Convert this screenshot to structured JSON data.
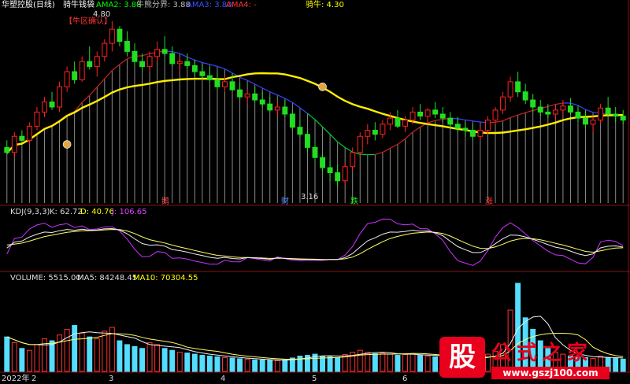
{
  "header": {
    "title": "华塑控股(日线)",
    "indicator_name": "骑牛钱袋",
    "items": [
      {
        "label": "AMA2: 3.88",
        "color": "#00ff00"
      },
      {
        "label": "牛熊分界: 3.88",
        "color": "#bbbbbb"
      },
      {
        "label": "AMA3: 3.80",
        "color": "#3355ff"
      },
      {
        "label": "AMA4: -",
        "color": "#ff3333"
      }
    ],
    "bull_label": "骑牛: 4.30",
    "bull_color": "#ffff00"
  },
  "annotations": {
    "high_price": "4.80",
    "low_price": "3.16",
    "bull_zone": "【牛区确认】",
    "markers": [
      {
        "text": "鹅",
        "color": "#ff4444"
      },
      {
        "text": "财",
        "color": "#4488ff"
      },
      {
        "text": "跌",
        "color": "#00ff00"
      },
      {
        "text": "涨",
        "color": "#ff3333"
      }
    ]
  },
  "kdj_panel": {
    "name": "KDJ(9,3,3)",
    "k_label": "K: 62.72",
    "d_label": "D: 40.76",
    "j_label": "J: 106.65"
  },
  "volume_panel": {
    "name": "VOLUME: 5515.00",
    "ma5_label": "MA5: 84248.45",
    "ma10_label": "MA10: 70304.55"
  },
  "x_axis": [
    "2022年",
    "2",
    "3",
    "4",
    "5",
    "6"
  ],
  "watermark": {
    "logo_char": "股",
    "title": "公式之家",
    "url": "www.gszj100.com"
  },
  "chart_data": {
    "type": "candlestick",
    "candles": [
      [
        3.55,
        3.62,
        3.48,
        3.5
      ],
      [
        3.5,
        3.7,
        3.45,
        3.66
      ],
      [
        3.66,
        3.72,
        3.6,
        3.62
      ],
      [
        3.62,
        3.8,
        3.58,
        3.76
      ],
      [
        3.76,
        3.95,
        3.72,
        3.9
      ],
      [
        3.9,
        4.05,
        3.85,
        4.0
      ],
      [
        4.0,
        4.1,
        3.92,
        3.95
      ],
      [
        3.95,
        4.2,
        3.9,
        4.15
      ],
      [
        4.15,
        4.35,
        4.1,
        4.3
      ],
      [
        4.3,
        4.4,
        4.18,
        4.22
      ],
      [
        4.22,
        4.45,
        4.2,
        4.4
      ],
      [
        4.4,
        4.55,
        4.32,
        4.35
      ],
      [
        4.35,
        4.5,
        4.25,
        4.45
      ],
      [
        4.45,
        4.62,
        4.4,
        4.58
      ],
      [
        4.58,
        4.8,
        4.5,
        4.72
      ],
      [
        4.72,
        4.75,
        4.55,
        4.6
      ],
      [
        4.6,
        4.7,
        4.45,
        4.5
      ],
      [
        4.5,
        4.58,
        4.35,
        4.4
      ],
      [
        4.4,
        4.48,
        4.3,
        4.35
      ],
      [
        4.35,
        4.5,
        4.3,
        4.45
      ],
      [
        4.45,
        4.6,
        4.4,
        4.52
      ],
      [
        4.52,
        4.65,
        4.45,
        4.48
      ],
      [
        4.48,
        4.55,
        4.35,
        4.38
      ],
      [
        4.38,
        4.45,
        4.28,
        4.4
      ],
      [
        4.4,
        4.48,
        4.33,
        4.36
      ],
      [
        4.36,
        4.42,
        4.25,
        4.3
      ],
      [
        4.3,
        4.38,
        4.22,
        4.26
      ],
      [
        4.26,
        4.35,
        4.2,
        4.22
      ],
      [
        4.22,
        4.3,
        4.12,
        4.15
      ],
      [
        4.15,
        4.25,
        4.1,
        4.2
      ],
      [
        4.2,
        4.28,
        4.1,
        4.12
      ],
      [
        4.12,
        4.18,
        4.02,
        4.05
      ],
      [
        4.05,
        4.12,
        3.98,
        4.08
      ],
      [
        4.08,
        4.15,
        4.0,
        4.02
      ],
      [
        4.02,
        4.1,
        3.95,
        3.98
      ],
      [
        3.98,
        4.05,
        3.9,
        3.92
      ],
      [
        3.92,
        4.0,
        3.86,
        3.95
      ],
      [
        3.95,
        4.02,
        3.85,
        3.88
      ],
      [
        3.88,
        3.92,
        3.72,
        3.75
      ],
      [
        3.75,
        3.82,
        3.65,
        3.68
      ],
      [
        3.68,
        3.72,
        3.5,
        3.55
      ],
      [
        3.55,
        3.6,
        3.4,
        3.45
      ],
      [
        3.45,
        3.5,
        3.3,
        3.35
      ],
      [
        3.35,
        3.42,
        3.22,
        3.3
      ],
      [
        3.3,
        3.38,
        3.16,
        3.22
      ],
      [
        3.22,
        3.4,
        3.18,
        3.36
      ],
      [
        3.36,
        3.55,
        3.32,
        3.5
      ],
      [
        3.5,
        3.7,
        3.46,
        3.66
      ],
      [
        3.66,
        3.78,
        3.58,
        3.72
      ],
      [
        3.72,
        3.8,
        3.62,
        3.68
      ],
      [
        3.68,
        3.82,
        3.64,
        3.78
      ],
      [
        3.78,
        3.9,
        3.72,
        3.84
      ],
      [
        3.84,
        3.92,
        3.74,
        3.76
      ],
      [
        3.76,
        3.86,
        3.7,
        3.82
      ],
      [
        3.82,
        3.95,
        3.78,
        3.9
      ],
      [
        3.9,
        3.98,
        3.82,
        3.86
      ],
      [
        3.86,
        3.94,
        3.78,
        3.92
      ],
      [
        3.92,
        4.0,
        3.84,
        3.88
      ],
      [
        3.88,
        3.95,
        3.8,
        3.84
      ],
      [
        3.84,
        3.9,
        3.74,
        3.78
      ],
      [
        3.78,
        3.85,
        3.7,
        3.74
      ],
      [
        3.74,
        3.8,
        3.66,
        3.72
      ],
      [
        3.72,
        3.78,
        3.62,
        3.66
      ],
      [
        3.66,
        3.75,
        3.62,
        3.72
      ],
      [
        3.72,
        3.86,
        3.68,
        3.82
      ],
      [
        3.82,
        3.95,
        3.78,
        3.92
      ],
      [
        3.92,
        4.1,
        3.88,
        4.05
      ],
      [
        4.05,
        4.25,
        4.0,
        4.2
      ],
      [
        4.2,
        4.3,
        4.05,
        4.1
      ],
      [
        4.1,
        4.18,
        3.98,
        4.02
      ],
      [
        4.02,
        4.08,
        3.9,
        3.95
      ],
      [
        3.95,
        4.02,
        3.86,
        3.9
      ],
      [
        3.9,
        3.98,
        3.84,
        3.88
      ],
      [
        3.88,
        3.96,
        3.82,
        3.92
      ],
      [
        3.92,
        4.02,
        3.86,
        3.96
      ],
      [
        3.96,
        4.04,
        3.88,
        3.9
      ],
      [
        3.9,
        3.96,
        3.8,
        3.84
      ],
      [
        3.84,
        3.92,
        3.74,
        3.78
      ],
      [
        3.78,
        3.86,
        3.7,
        3.82
      ],
      [
        3.82,
        3.98,
        3.78,
        3.94
      ],
      [
        3.94,
        4.05,
        3.85,
        3.88
      ],
      [
        3.88,
        3.95,
        3.8,
        3.86
      ],
      [
        3.86,
        3.92,
        3.78,
        3.82
      ]
    ],
    "volumes": [
      90,
      75,
      60,
      55,
      70,
      85,
      80,
      95,
      110,
      120,
      100,
      90,
      85,
      105,
      115,
      80,
      70,
      65,
      60,
      75,
      70,
      60,
      55,
      50,
      48,
      45,
      42,
      40,
      38,
      36,
      35,
      33,
      32,
      30,
      30,
      29,
      28,
      30,
      35,
      40,
      42,
      45,
      40,
      38,
      36,
      44,
      50,
      55,
      50,
      46,
      48,
      45,
      42,
      44,
      46,
      42,
      40,
      38,
      36,
      35,
      34,
      33,
      32,
      38,
      45,
      52,
      70,
      160,
      230,
      140,
      110,
      80,
      60,
      50,
      45,
      40,
      38,
      36,
      34,
      40,
      36,
      34,
      32
    ],
    "title": "",
    "ylim": [
      3.0,
      4.9
    ]
  }
}
